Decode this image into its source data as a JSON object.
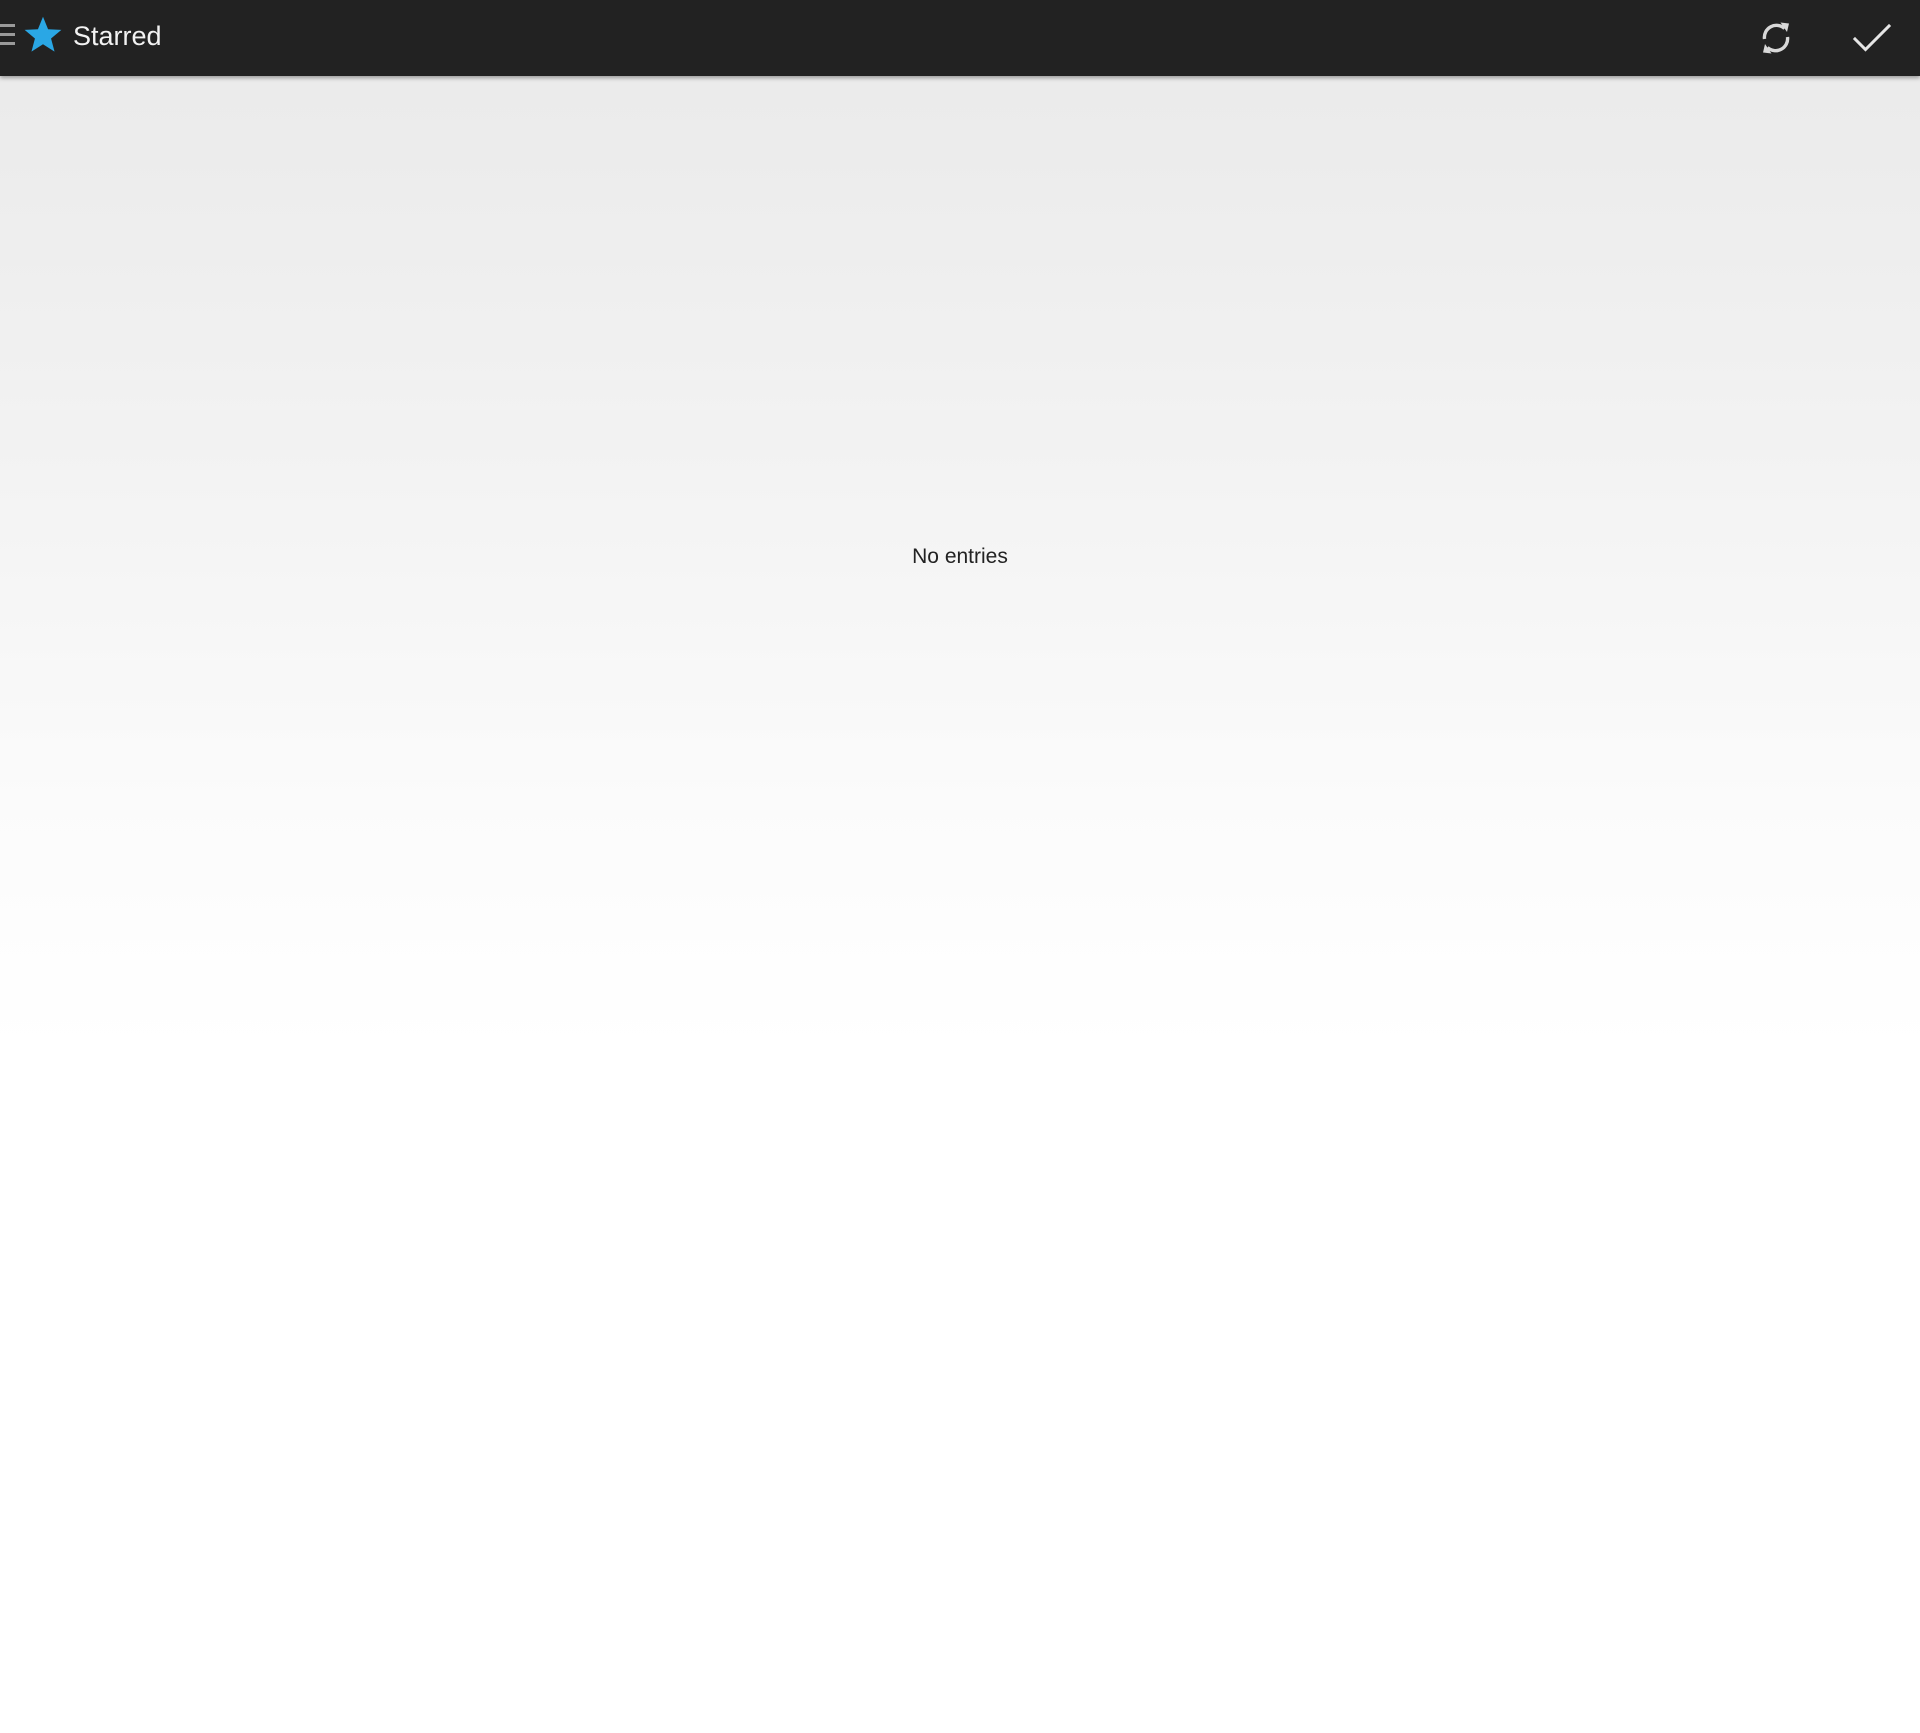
{
  "action_bar": {
    "title": "Starred",
    "icons": {
      "drawer": "menu-icon",
      "app": "star-icon",
      "refresh": "refresh-icon",
      "mark_read": "check-icon"
    }
  },
  "main": {
    "empty_message": "No entries"
  },
  "colors": {
    "action_bar_bg": "#222222",
    "star_accent": "#2aa7e5",
    "title_text": "#f2f2f2",
    "action_icon": "#d8d8d8",
    "body_text": "#222222"
  }
}
